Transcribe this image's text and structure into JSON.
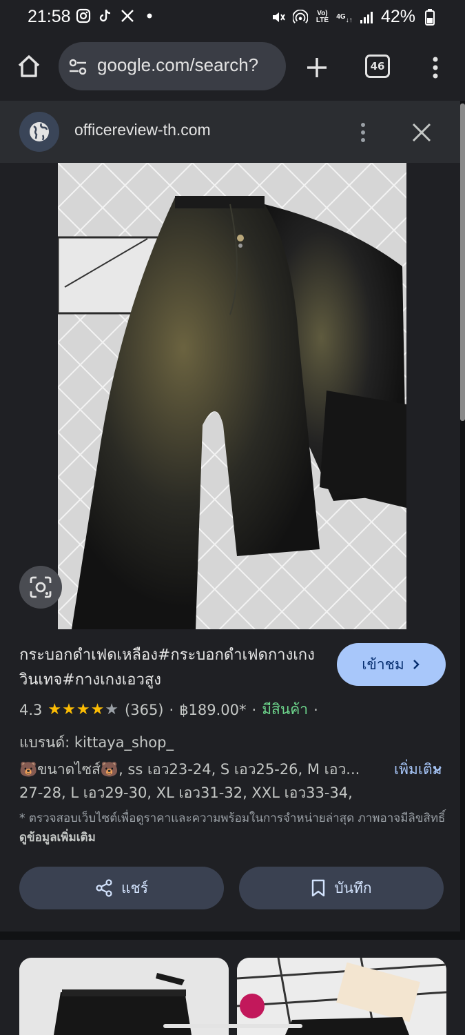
{
  "status": {
    "time": "21:58",
    "battery": "42%",
    "volte": "Vo)\nLTE",
    "network": "4G"
  },
  "browser": {
    "url": "google.com/search?",
    "tab_count": "46"
  },
  "sheet": {
    "site": "officereview-th.com"
  },
  "product": {
    "title": "กระบอกดำเฟดเหลือง#กระบอกดำเฟดกางเกงวินเทจ#กางเกงเอวสูง",
    "visit_label": "เข้าชม",
    "rating": "4.3",
    "stars": "★★★★",
    "half_star": "★",
    "reviews": "(365)",
    "sep": "·",
    "price": "฿189.00*",
    "availability": "มีสินค้า",
    "brand": "แบรนด์: kittaya_shop_",
    "description": "🐻ขนาดไซส์🐻, ss เอว23-24, S เอว25-26, M เอว... 27-28, L เอว29-30, XL เอว31-32, XXL เอว33-34,",
    "more_label": "เพิ่มเติม",
    "note": "* ตรวจสอบเว็บไซต์เพื่อดูราคาและความพร้อมในการจำหน่ายล่าสุด ภาพอาจมีลิขสิทธิ์ ",
    "note_link": "ดูข้อมูลเพิ่มเติม",
    "share_label": "แชร์",
    "save_label": "บันทึก"
  },
  "colors": {
    "accent": "#a8c7fa",
    "instock": "#6dd58c",
    "star": "#fbbc04",
    "background": "#1f2024"
  }
}
